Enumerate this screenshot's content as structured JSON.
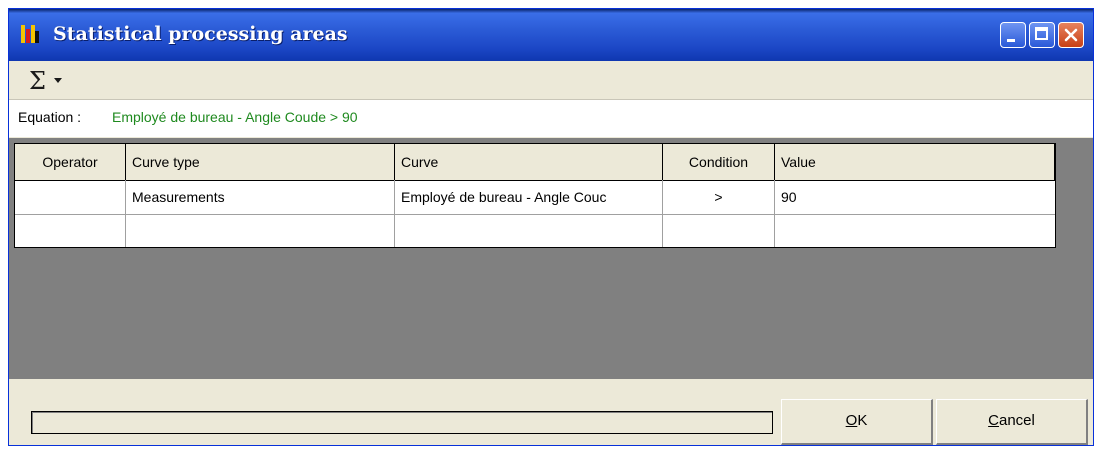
{
  "window": {
    "title": "Statistical processing areas"
  },
  "toolbar": {
    "sigma_icon": "sigma-dropdown-icon"
  },
  "equation": {
    "label": "Equation :",
    "value": "Employé de bureau - Angle Coude > 90",
    "value_color": "#1f8a1f"
  },
  "grid": {
    "columns": [
      "Operator",
      "Curve type",
      "Curve",
      "Condition",
      "Value"
    ],
    "rows": [
      {
        "operator": "",
        "curve_type": "Measurements",
        "curve": "Employé de bureau - Angle Couc",
        "condition": ">",
        "value": "90"
      },
      {
        "operator": "",
        "curve_type": "",
        "curve": "",
        "condition": "",
        "value": ""
      }
    ]
  },
  "progress": {
    "value": 0
  },
  "buttons": {
    "ok": {
      "mnemonic": "O",
      "rest": "K"
    },
    "cancel": {
      "mnemonic": "C",
      "rest": "ancel"
    }
  },
  "colors": {
    "title_bar": "#2b5bd6",
    "grid_background": "#808080",
    "window_background": "#ece9d8"
  }
}
